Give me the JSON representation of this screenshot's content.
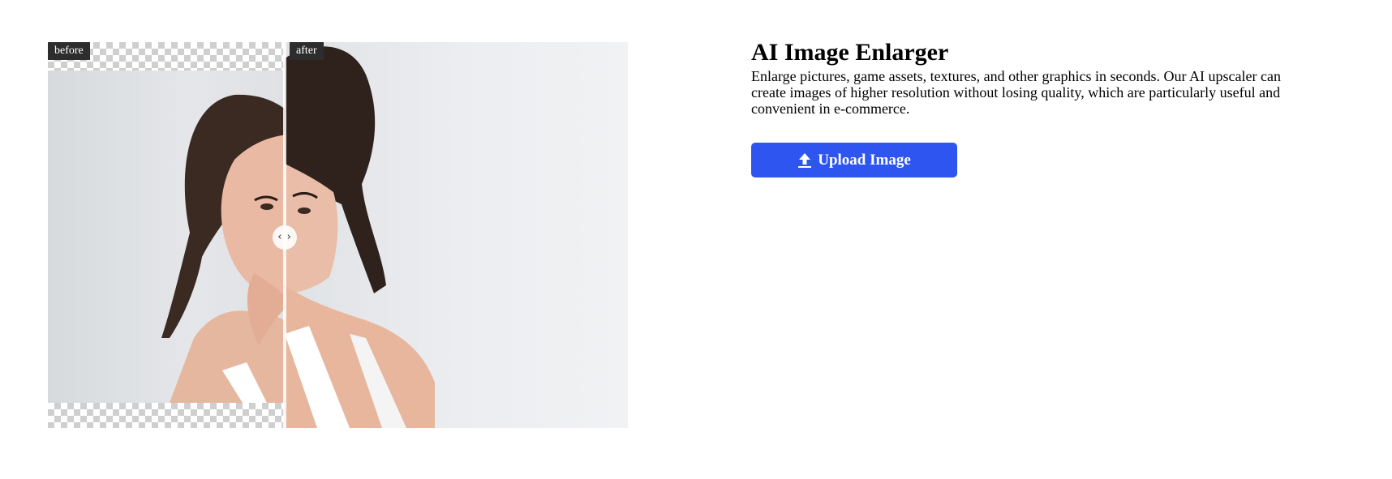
{
  "compare": {
    "before_label": "before",
    "after_label": "after",
    "handle_glyph": "‹ ›",
    "slider_position_fraction": 0.41
  },
  "info": {
    "title": "AI Image Enlarger",
    "description": "Enlarge pictures, game assets, textures, and other graphics in seconds. Our AI upscaler can create images of higher resolution without losing quality, which are particularly useful and convenient in e-commerce.",
    "upload_label": "Upload Image",
    "upload_icon": "upload-arrow-icon"
  },
  "colors": {
    "accent": "#2f55f0",
    "tag_background": "#2d2d2d",
    "lip": "#d8121c"
  }
}
